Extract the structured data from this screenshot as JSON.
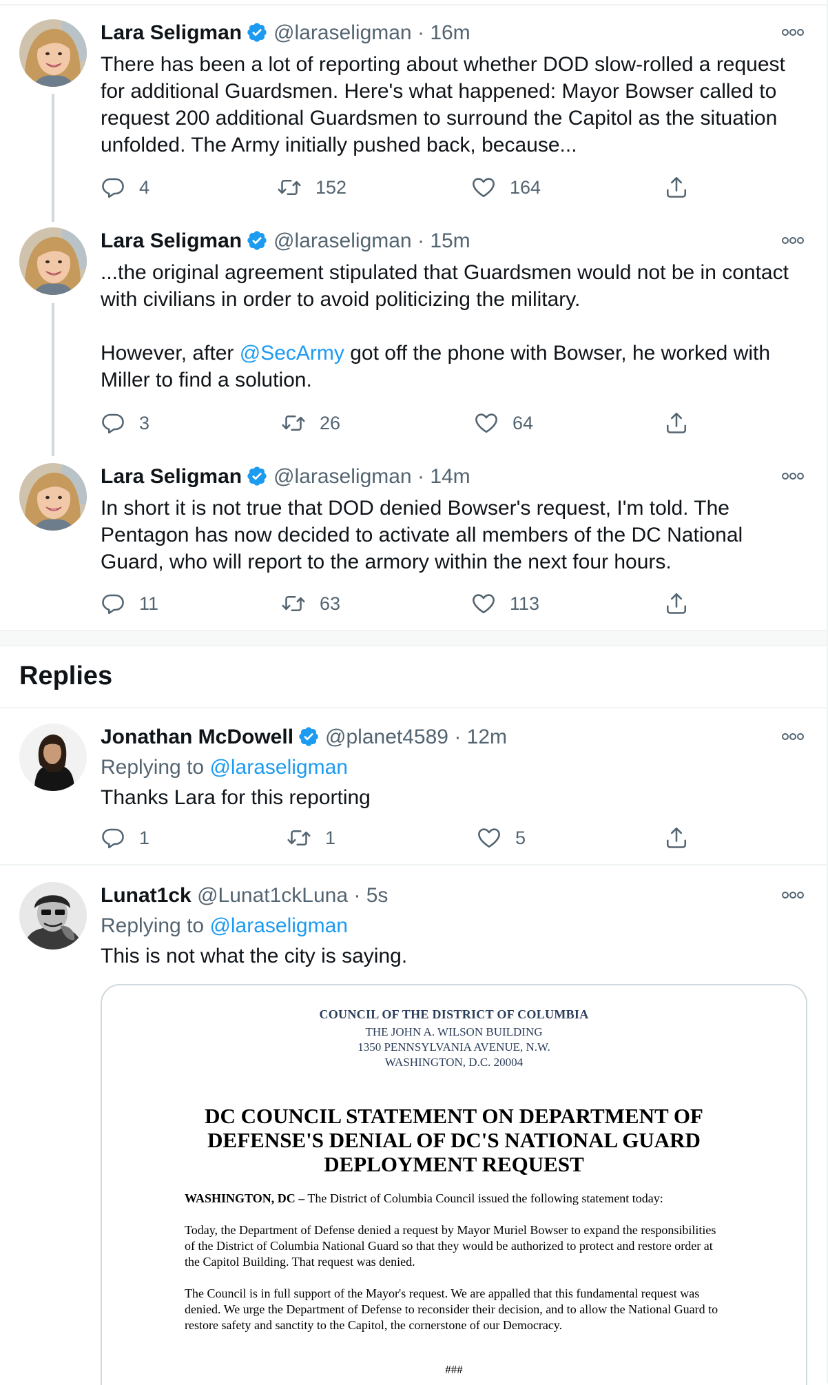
{
  "colors": {
    "accent": "#1d9bf0",
    "muted": "#536471",
    "text": "#0f1419",
    "border": "#eff3f4"
  },
  "thread": [
    {
      "name": "Lara Seligman",
      "handle": "@laraseligman",
      "dot": "·",
      "time": "16m",
      "text": "There has been a lot of reporting about whether DOD slow-rolled a request for additional Guardsmen. Here's what happened: Mayor Bowser called to request 200 additional Guardsmen to surround the Capitol as the situation unfolded. The Army initially pushed back, because...",
      "replies": "4",
      "retweets": "152",
      "likes": "164"
    },
    {
      "name": "Lara Seligman",
      "handle": "@laraseligman",
      "dot": "·",
      "time": "15m",
      "text_line1": "...the original agreement stipulated that Guardsmen would not be in contact with civilians in order to avoid politicizing the military.",
      "text_pre": "However, after ",
      "text_mention": "@SecArmy",
      "text_post": " got off the phone with Bowser, he worked with Miller to find a solution.",
      "replies": "3",
      "retweets": "26",
      "likes": "64"
    },
    {
      "name": "Lara Seligman",
      "handle": "@laraseligman",
      "dot": "·",
      "time": "14m",
      "text": "In short it is not true that DOD denied Bowser's request, I'm told. The Pentagon has now decided to activate all members of the DC National Guard, who will report to the armory within the next four hours.",
      "replies": "11",
      "retweets": "63",
      "likes": "113"
    }
  ],
  "replies_heading": "Replies",
  "replies": [
    {
      "name": "Jonathan McDowell",
      "handle": "@planet4589",
      "dot": "·",
      "time": "12m",
      "replying_label": "Replying to ",
      "replying_to": "@laraseligman",
      "text": "Thanks Lara for this reporting",
      "replies": "1",
      "retweets": "1",
      "likes": "5"
    },
    {
      "name": "Lunat1ck",
      "handle": "@Lunat1ckLuna",
      "dot": "·",
      "time": "5s",
      "replying_label": "Replying to ",
      "replying_to": "@laraseligman",
      "text": "This is not what the city is saying."
    }
  ],
  "document": {
    "org": "COUNCIL OF THE DISTRICT OF COLUMBIA",
    "building": "THE JOHN A. WILSON BUILDING",
    "street": "1350 PENNSYLVANIA AVENUE, N.W.",
    "city": "WASHINGTON, D.C. 20004",
    "title": "DC COUNCIL STATEMENT ON DEPARTMENT OF DEFENSE'S DENIAL OF DC'S NATIONAL GUARD DEPLOYMENT REQUEST",
    "dateline": "WASHINGTON, DC –",
    "lead": " The District of Columbia Council issued the following statement today:",
    "para1": "Today, the Department of Defense denied a request by Mayor Muriel Bowser to expand the responsibilities of the District of Columbia National Guard so that they would be authorized to protect and restore order at the Capitol Building. That request was denied.",
    "para2": "The Council is in full support of the Mayor's request. We are appalled that this fundamental request was denied. We urge the Department of Defense to reconsider their decision, and to allow the National Guard to restore safety and sanctity to the Capitol, the cornerstone of our Democracy.",
    "end": "###"
  }
}
